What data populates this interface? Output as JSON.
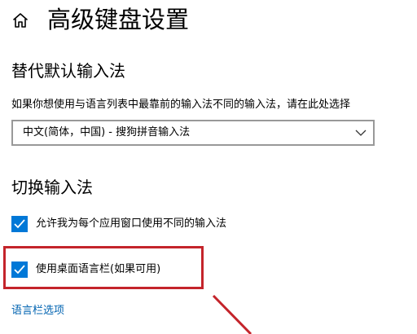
{
  "header": {
    "home_icon": "home-icon",
    "title": "高级键盘设置"
  },
  "override_section": {
    "heading": "替代默认输入法",
    "description": "如果你想使用与语言列表中最靠前的输入法不同的输入法，请在此处选择",
    "dropdown": {
      "selected_value": "中文(简体，中国) - 搜狗拼音输入法",
      "icon": "chevron-down-icon"
    }
  },
  "switch_section": {
    "heading": "切换输入法",
    "options": [
      {
        "label": "允许我为每个应用窗口使用不同的输入法",
        "checked": true
      },
      {
        "label": "使用桌面语言栏(如果可用)",
        "checked": true
      }
    ],
    "language_bar_link": "语言栏选项"
  },
  "annotation": {
    "highlight_color": "#c4242b"
  },
  "colors": {
    "accent": "#0078d7",
    "link": "#0063b1",
    "dropdown_border": "#999999"
  }
}
